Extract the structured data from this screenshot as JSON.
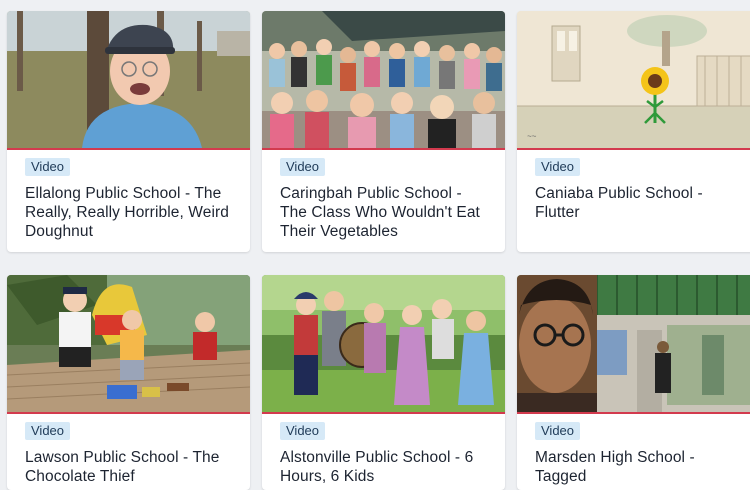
{
  "cards": [
    {
      "badge": "Video",
      "title": "Ellalong Public School - The Really, Really Horrible, Weird Doughnut",
      "thumb_icon": "boy-smiling-outdoors-thumbnail"
    },
    {
      "badge": "Video",
      "title": "Caringbah Public School - The Class Who Wouldn't Eat Their Vegetables",
      "thumb_icon": "class-group-photo-thumbnail"
    },
    {
      "badge": "Video",
      "title": "Caniaba Public School - Flutter",
      "thumb_icon": "animated-sunflower-thumbnail"
    },
    {
      "badge": "Video",
      "title": "Lawson Public School - The Chocolate Thief",
      "thumb_icon": "kids-on-deck-thumbnail"
    },
    {
      "badge": "Video",
      "title": "Alstonville Public School - 6 Hours, 6 Kids",
      "thumb_icon": "kids-in-garden-thumbnail"
    },
    {
      "badge": "Video",
      "title": "Marsden High School - Tagged",
      "thumb_icon": "student-closeup-thumbnail"
    }
  ],
  "colors": {
    "accent_line": "#d33a4e",
    "badge_bg": "#d6e9f7",
    "page_bg": "#eef0f3"
  }
}
